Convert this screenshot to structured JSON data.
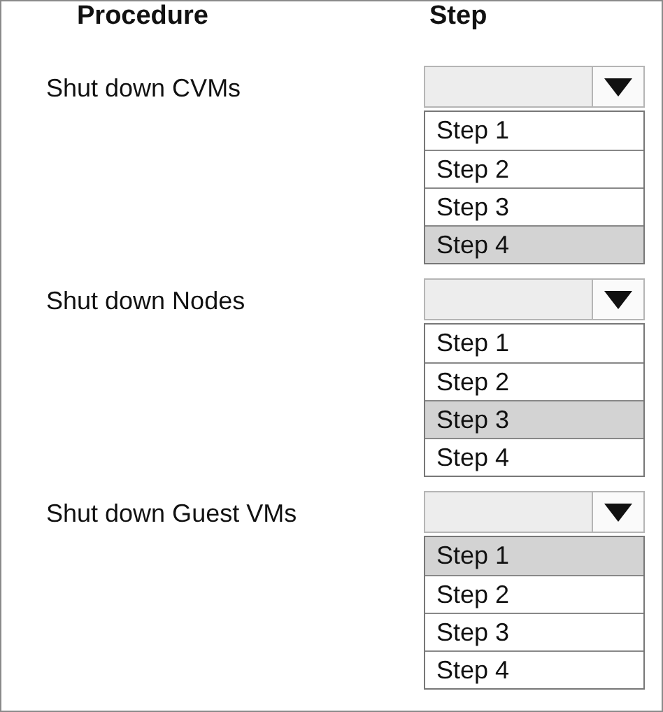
{
  "headers": {
    "procedure": "Procedure",
    "step": "Step"
  },
  "rows": [
    {
      "procedure": "Shut down CVMs",
      "options": [
        {
          "label": "Step 1",
          "selected": false
        },
        {
          "label": "Step 2",
          "selected": false
        },
        {
          "label": "Step 3",
          "selected": false
        },
        {
          "label": "Step 4",
          "selected": true
        }
      ]
    },
    {
      "procedure": "Shut down Nodes",
      "options": [
        {
          "label": "Step 1",
          "selected": false
        },
        {
          "label": "Step 2",
          "selected": false
        },
        {
          "label": "Step 3",
          "selected": true
        },
        {
          "label": "Step 4",
          "selected": false
        }
      ]
    },
    {
      "procedure": "Shut down Guest VMs",
      "options": [
        {
          "label": "Step 1",
          "selected": true
        },
        {
          "label": "Step 2",
          "selected": false
        },
        {
          "label": "Step 3",
          "selected": false
        },
        {
          "label": "Step 4",
          "selected": false
        }
      ]
    }
  ]
}
